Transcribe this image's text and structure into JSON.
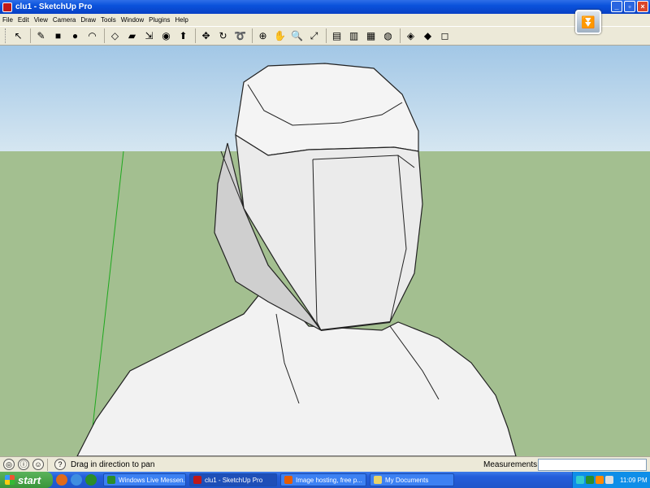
{
  "window": {
    "title": "clu1 - SketchUp Pro"
  },
  "menu": [
    "File",
    "Edit",
    "View",
    "Camera",
    "Draw",
    "Tools",
    "Window",
    "Plugins",
    "Help"
  ],
  "toolbar": {
    "tools": [
      {
        "name": "select-tool",
        "glyph": "↖"
      },
      {
        "name": "pencil-tool",
        "glyph": "✎"
      },
      {
        "name": "rectangle-tool",
        "glyph": "■"
      },
      {
        "name": "circle-tool",
        "glyph": "●"
      },
      {
        "name": "arc-tool",
        "glyph": "◠"
      },
      {
        "name": "make-component-tool",
        "glyph": "◇"
      },
      {
        "name": "eraser-tool",
        "glyph": "▰"
      },
      {
        "name": "tape-measure-tool",
        "glyph": "⇲"
      },
      {
        "name": "paint-bucket-tool",
        "glyph": "◉"
      },
      {
        "name": "push-pull-tool",
        "glyph": "⬆"
      },
      {
        "name": "move-tool",
        "glyph": "✥"
      },
      {
        "name": "rotate-tool",
        "glyph": "↻"
      },
      {
        "name": "follow-me-tool",
        "glyph": "➰"
      },
      {
        "name": "orbit-tool",
        "glyph": "⊕"
      },
      {
        "name": "pan-tool",
        "glyph": "✋"
      },
      {
        "name": "zoom-tool",
        "glyph": "🔍"
      },
      {
        "name": "zoom-extents-tool",
        "glyph": "⤢"
      },
      {
        "name": "get-models-tool",
        "glyph": "▤"
      },
      {
        "name": "share-model-tool",
        "glyph": "▥"
      },
      {
        "name": "photo-textures-tool",
        "glyph": "▦"
      },
      {
        "name": "google-earth-tool",
        "glyph": "◍"
      },
      {
        "name": "extension-warehouse-tool",
        "glyph": "◈"
      },
      {
        "name": "layout-tool",
        "glyph": "◆"
      },
      {
        "name": "section-tool",
        "glyph": "◻"
      }
    ]
  },
  "statusbar": {
    "status_text": "Drag in direction to pan",
    "measurements_label": "Measurements",
    "help_glyph": "?"
  },
  "taskbar": {
    "start_label": "start",
    "tasks": [
      {
        "label": "Windows Live Messen...",
        "color": "#2a8d2a"
      },
      {
        "label": "clu1 - SketchUp Pro",
        "color": "#c01818"
      },
      {
        "label": "Image hosting, free p...",
        "color": "#e65c00"
      },
      {
        "label": "My Documents",
        "color": "#e8d36a"
      }
    ],
    "clock": "11:09 PM"
  },
  "colors": {
    "sky": "#a2c7e6",
    "ground": "#a3bf90",
    "titlebar": "#0a52dc"
  }
}
